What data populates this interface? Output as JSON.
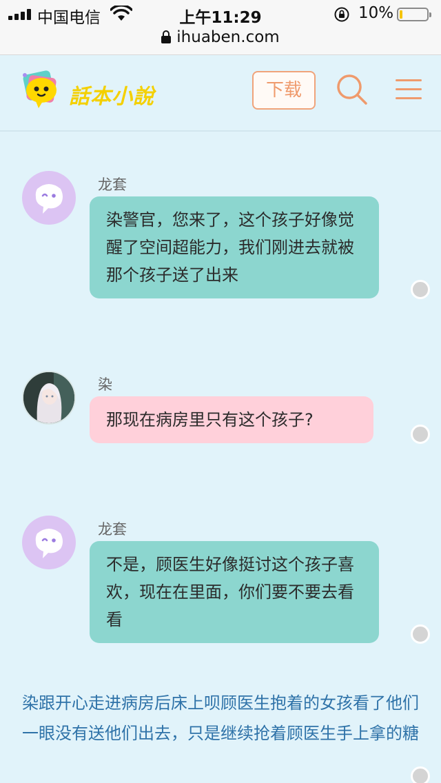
{
  "status_bar": {
    "carrier": "中国电信",
    "time": "上午11:29",
    "battery_percent": "10%",
    "battery_level": 0.1
  },
  "browser": {
    "url": "ihuaben.com"
  },
  "header": {
    "logo_text": "話本小說",
    "download_label": "下载"
  },
  "messages": [
    {
      "speaker": "龙套",
      "avatar": "placeholder-ghost-avatar",
      "text": "染警官，您来了，这个孩子好像觉醒了空间超能力，我们刚进去就被那个孩子送了出来",
      "bubble_color": "#8cd6cf"
    },
    {
      "speaker": "染",
      "avatar": "anime-girl-photo-avatar",
      "text": "那现在病房里只有这个孩子?",
      "bubble_color": "#ffd0da"
    },
    {
      "speaker": "龙套",
      "avatar": "placeholder-ghost-avatar",
      "text": "不是，顾医生好像挺讨这个孩子喜欢，现在在里面，你们要不要去看看",
      "bubble_color": "#8cd6cf"
    }
  ],
  "narration": "染跟开心走进病房后床上呗顾医生抱着的女孩看了他们一眼没有送他们出去，只是继续抢着顾医生手上拿的糖",
  "colors": {
    "background": "#e1f3fa",
    "accent": "#ef9a6c",
    "narration": "#2e72a8"
  }
}
